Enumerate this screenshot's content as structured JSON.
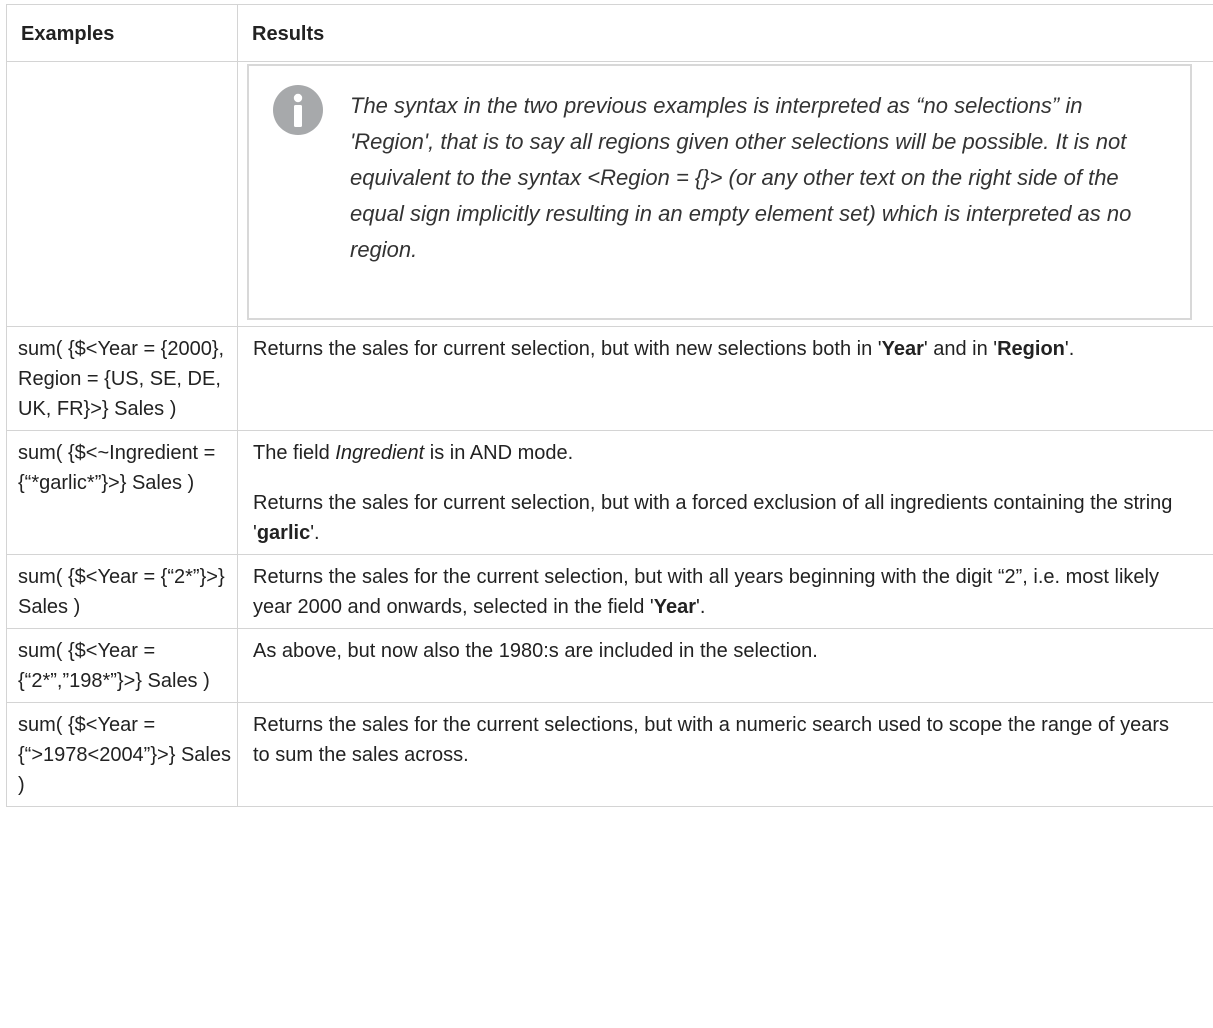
{
  "header": {
    "col_examples": "Examples",
    "col_results": "Results"
  },
  "note": {
    "icon": "info-icon",
    "text": "The syntax in the two previous examples is interpreted as “no selections” in 'Region', that is to say all regions given other selections will be possible. It is not equivalent to the syntax <Region = {}> (or any other text on the right side of the equal sign implicitly resulting in an empty element set) which is interpreted as no region."
  },
  "rows": [
    {
      "example": "sum( {$<Year = {2000}, Region = {US, SE, DE, UK, FR}>} Sales )",
      "result": {
        "t1": "Returns the sales for current selection, but with new selections both in '",
        "b1": "Year",
        "t2": "' and in '",
        "b2": "Region",
        "t3": "'."
      }
    },
    {
      "example": "sum( {$<~Ingredient = {“*garlic*”}>} Sales )",
      "result": {
        "p1_t1": "The field ",
        "p1_i1": "Ingredient",
        "p1_t2": " is in AND mode.",
        "p2_t1": "Returns the sales for current selection, but with a forced exclusion of all ingredients containing the string '",
        "p2_b1": "garlic",
        "p2_t2": "'."
      }
    },
    {
      "example": "sum( {$<Year = {“2*”}>} Sales )",
      "result": {
        "t1": "Returns the sales for the current selection, but with all years beginning with the digit “2”, i.e. most likely year 2000 and onwards, selected in the field '",
        "b1": "Year",
        "t2": "'."
      }
    },
    {
      "example": "sum( {$<Year = {“2*”,”198*”}>} Sales )",
      "result": {
        "t1": "As above, but now also the 1980:s are included in the selection."
      }
    },
    {
      "example": "sum( {$<Year = {“>1978<2004”}>} Sales )",
      "result": {
        "t1": "Returns the sales for the current selections, but with a numeric search used to scope the range of years to sum the sales across."
      }
    }
  ],
  "colors": {
    "border": "#d4d4d4",
    "note_border": "#d8d8d8",
    "icon": "#a7a9ab",
    "text": "#222222"
  }
}
